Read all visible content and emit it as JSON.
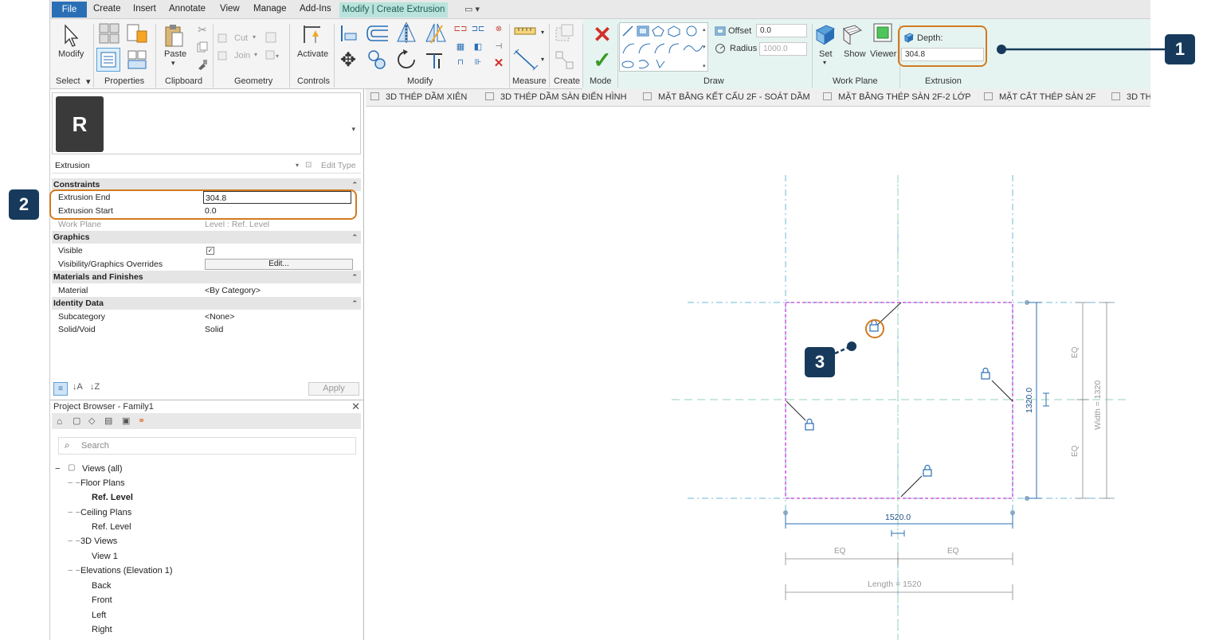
{
  "menu": {
    "file": "File",
    "items": [
      "Create",
      "Insert",
      "Annotate",
      "View",
      "Manage",
      "Add-Ins"
    ],
    "context_tab": "Modify | Create Extrusion"
  },
  "ribbon": {
    "modify_label": "Modify",
    "paste_label": "Paste",
    "cut_label": "Cut",
    "join_label": "Join",
    "activate_label": "Activate",
    "measure_label": "Measure",
    "create_label": "Create",
    "mode_label": "Mode",
    "offset_label": "Offset",
    "offset_value": "0.0",
    "radius_label": "Radius",
    "radius_value": "1000.0",
    "set_label": "Set",
    "show_label": "Show",
    "viewer_label": "Viewer",
    "depth_label": "Depth:",
    "depth_value": "304.8",
    "groups": {
      "select": "Select",
      "properties": "Properties",
      "clipboard": "Clipboard",
      "geometry": "Geometry",
      "controls": "Controls",
      "modify": "Modify",
      "measure": "Measure",
      "create": "Create",
      "mode": "Mode",
      "draw": "Draw",
      "work_plane": "Work Plane",
      "extrusion": "Extrusion"
    }
  },
  "view_tabs": [
    "3D THÉP DẦM XIÊN",
    "3D THÉP DẦM SÀN ĐIỂN HÌNH",
    "MẶT BẰNG KẾT CẤU 2F - SOÁT DẦM",
    "MẶT BẰNG THÉP SÀN 2F-2 LỚP",
    "MẶT CẮT THÉP SÀN 2F",
    "3D TH"
  ],
  "properties": {
    "type_letter": "R",
    "type_name": "Extrusion",
    "edit_type": "Edit Type",
    "apply": "Apply",
    "rows": {
      "constraints": "Constraints",
      "extrusion_end_label": "Extrusion End",
      "extrusion_end_value": "304.8",
      "extrusion_start_label": "Extrusion Start",
      "extrusion_start_value": "0.0",
      "work_plane_label": "Work Plane",
      "work_plane_value": "Level : Ref. Level",
      "graphics": "Graphics",
      "visible_label": "Visible",
      "vis_overrides_label": "Visibility/Graphics Overrides",
      "vis_overrides_value": "Edit...",
      "materials": "Materials and Finishes",
      "material_label": "Material",
      "material_value": "<By Category>",
      "identity": "Identity Data",
      "subcategory_label": "Subcategory",
      "subcategory_value": "<None>",
      "solid_void_label": "Solid/Void",
      "solid_void_value": "Solid"
    }
  },
  "browser": {
    "title": "Project Browser - Family1",
    "search_placeholder": "Search",
    "tree": {
      "views_all": "Views (all)",
      "floor_plans": "Floor Plans",
      "ref_level_bold": "Ref. Level",
      "ceiling_plans": "Ceiling Plans",
      "ref_level": "Ref. Level",
      "views_3d": "3D Views",
      "view1": "View 1",
      "elevations": "Elevations (Elevation 1)",
      "back": "Back",
      "front": "Front",
      "left": "Left",
      "right": "Right"
    }
  },
  "canvas": {
    "dim_width_value": "1520.0",
    "dim_height_value": "1320.0",
    "eq": "EQ",
    "length_label": "Length = 1520",
    "width_label": "Width = 1320"
  },
  "callouts": [
    "1",
    "2",
    "3"
  ],
  "colors": {
    "highlight": "#d27a1e",
    "callout": "#173a5c",
    "sketch": "#c03ad8",
    "refplane": "#6fb8d6"
  }
}
